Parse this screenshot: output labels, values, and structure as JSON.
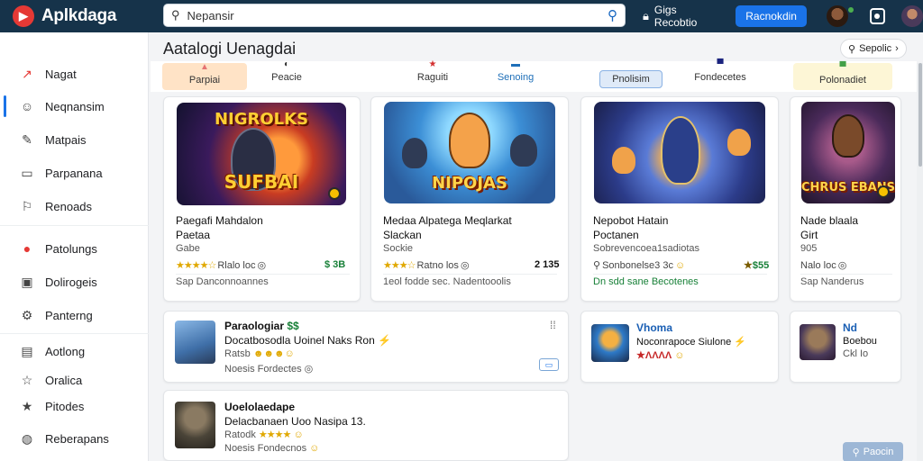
{
  "app": {
    "name": "Aplkdaga",
    "logo_icon": "play-logo-icon"
  },
  "search": {
    "value": "Nepansir"
  },
  "header": {
    "text": "Gigs Recobtio",
    "primary_button": "Racnokdin"
  },
  "sidebar": {
    "items": [
      {
        "label": "Nagat",
        "icon": "trending-icon"
      },
      {
        "label": "Neqnansim",
        "icon": "smiley-icon"
      },
      {
        "label": "Matpais",
        "icon": "pen-icon"
      },
      {
        "label": "Parpanana",
        "icon": "chat-icon"
      },
      {
        "label": "Renoads",
        "icon": "flag-icon"
      },
      {
        "label": "Patolungs",
        "icon": "record-icon"
      },
      {
        "label": "Dolirogeis",
        "icon": "card-icon"
      },
      {
        "label": "Panterng",
        "icon": "gear-icon"
      },
      {
        "label": "Aotlong",
        "icon": "folder-icon"
      },
      {
        "label": "Oralica",
        "icon": "star-outline-icon"
      },
      {
        "label": "Pitodes",
        "icon": "star-icon"
      },
      {
        "label": "Reberapans",
        "icon": "globe-icon"
      }
    ]
  },
  "main": {
    "title": "Aatalogi Uenagdai",
    "filter_label": "Sepolic",
    "categories": [
      {
        "label": "Parpiai",
        "icon": "▲"
      },
      {
        "label": "Peacie",
        "icon": "◐"
      },
      {
        "label": "Raguiti",
        "icon": "★"
      },
      {
        "label": "Senoing",
        "icon": "▬"
      },
      {
        "label": "Pnolisim",
        "icon": "◆"
      },
      {
        "label": "Fondecetes",
        "icon": "▀"
      },
      {
        "label": "Polonadiet",
        "icon": "▀"
      }
    ],
    "featured": [
      {
        "art_top": "NIGROLKS",
        "art_title": "SUFBAI",
        "title": "Paegafi Mahdalon",
        "sub": "Paetaa",
        "category": "Gabe",
        "rating": "Rlalo loc",
        "price": "$ 3B",
        "foot": "Sap Danconnoannes"
      },
      {
        "art_top": "",
        "art_title": "NIPOJAS",
        "title": "Medaa Alpatega Meqlarkat",
        "sub": "Slackan",
        "category": "Sockie",
        "rating": "Ratno los",
        "price": "2 135",
        "foot": "1eol fodde sec. Nadentooolis"
      },
      {
        "art_top": "",
        "art_title": "",
        "title": "Nepobot Hatain",
        "sub": "Poctanen",
        "category": "Sobrevencoea1sadiotas",
        "rating": "Sonbonelse3 3c",
        "price": "$55",
        "foot": "Dn sdd sane Becotenes"
      },
      {
        "art_top": "",
        "art_title": "CHRUS EBANS",
        "title": "Nade blaala",
        "sub": "Girt",
        "category": "905",
        "rating": "Nalo loc",
        "price": "",
        "foot": "Sap Nanderus"
      }
    ],
    "list": [
      {
        "title": "Paraologiar",
        "line2": "Docatbosodla Uoinel Naks Ron",
        "line3": "Ratsb",
        "foot": "Noesis Fordectes"
      },
      {
        "title": "Vhoma",
        "line2": "Noconrapoce Siulone",
        "line3": "",
        "foot": ""
      },
      {
        "title": "Nd",
        "line2": "Boebou",
        "line3": "Ckl Io",
        "foot": ""
      },
      {
        "title": "Uoelolaedape",
        "line2": "Delacbanaen Uoo Nasipa 13.",
        "line3": "Ratodk",
        "foot": "Noesis Fondecnos"
      }
    ],
    "mini_button": "▭",
    "floating_button": "Paocin"
  },
  "colors": {
    "topbar": "#16334a",
    "accent": "#1a73e8",
    "logo": "#e53935",
    "price_green": "#188038"
  }
}
